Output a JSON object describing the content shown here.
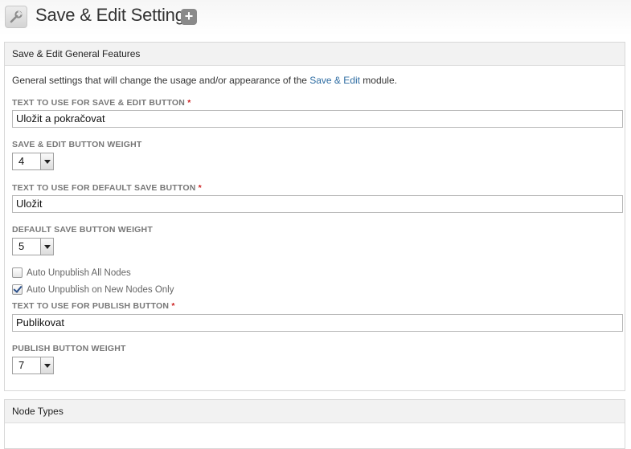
{
  "header": {
    "title": "Save & Edit Settings",
    "add_label": "+",
    "tool_icon": "wrench-icon"
  },
  "general": {
    "legend": "Save & Edit General Features",
    "desc_before": "General settings that will change the usage and/or appearance of the ",
    "desc_link": "Save & Edit",
    "desc_after": " module.",
    "save_edit_label": "Text to use for Save & Edit button",
    "save_edit_value": "Uložit a pokračovat",
    "save_edit_weight_label": "Save & Edit button weight",
    "save_edit_weight": "4",
    "default_save_label": "Text to use for default save button",
    "default_save_value": "Uložit",
    "default_save_weight_label": "Default save button weight",
    "default_save_weight": "5",
    "auto_unpublish_all_label": "Auto Unpublish All Nodes",
    "auto_unpublish_all_checked": false,
    "auto_unpublish_new_label": "Auto Unpublish on New Nodes Only",
    "auto_unpublish_new_checked": true,
    "publish_label": "Text to use for publish button",
    "publish_value": "Publikovat",
    "publish_weight_label": "Publish button weight",
    "publish_weight": "7",
    "required_marker": "*"
  },
  "node_types": {
    "legend": "Node Types"
  },
  "colors": {
    "link": "#2d6ca2",
    "required": "#cc1f1f",
    "checkbox_check": "#2a4f8a"
  }
}
